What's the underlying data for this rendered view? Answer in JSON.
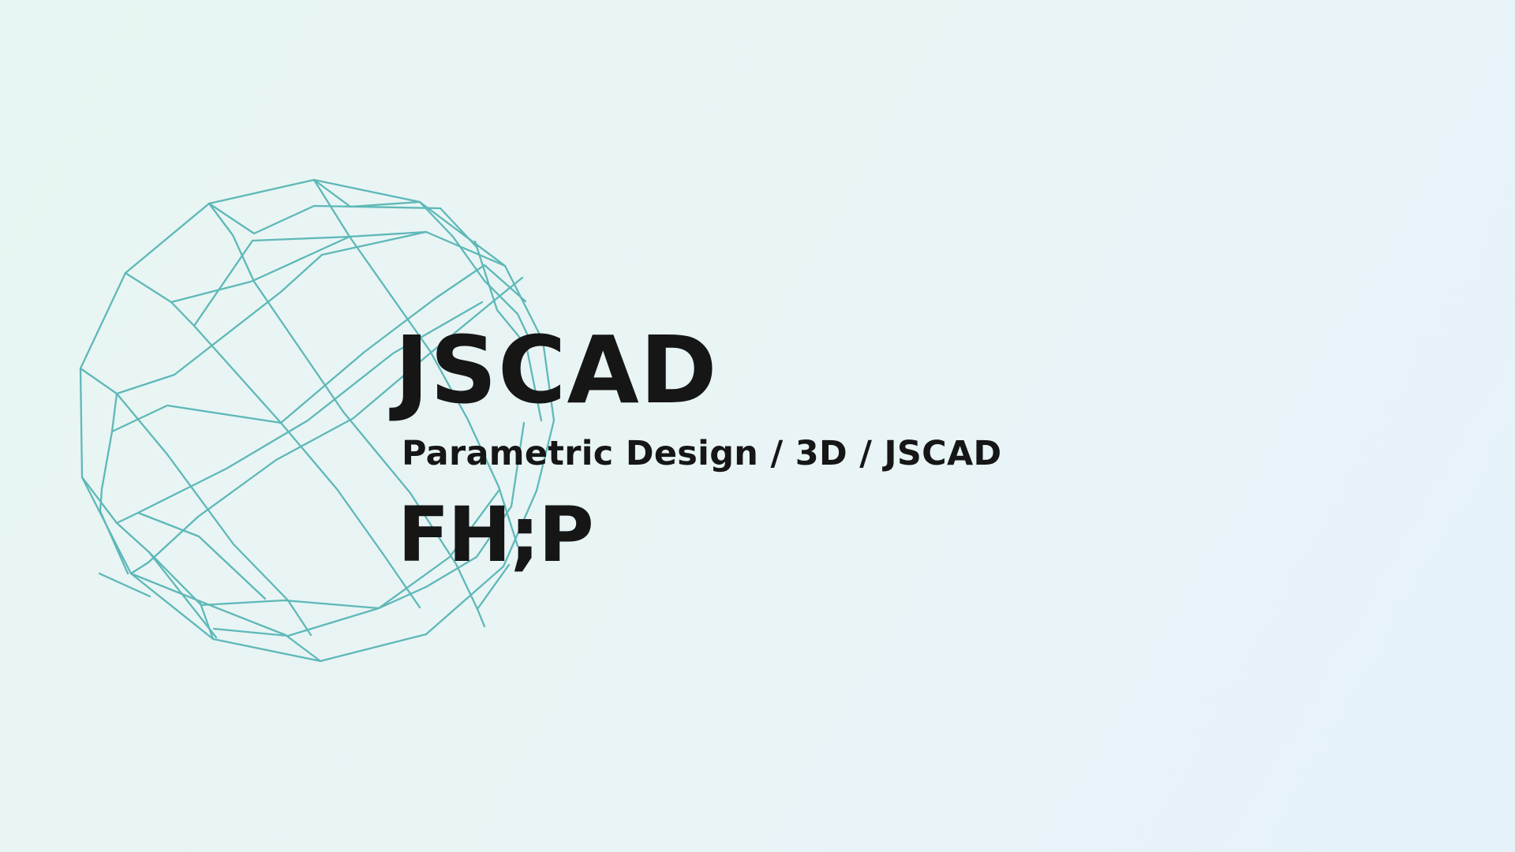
{
  "title": "JSCAD",
  "subtitle": "Parametric Design / 3D / JSCAD",
  "logo_text": "FH;P",
  "graphic": {
    "name": "wireframe-sphere",
    "stroke_color": "#5fb8b8"
  },
  "colors": {
    "text": "#161616",
    "accent": "#5fb8b8"
  }
}
